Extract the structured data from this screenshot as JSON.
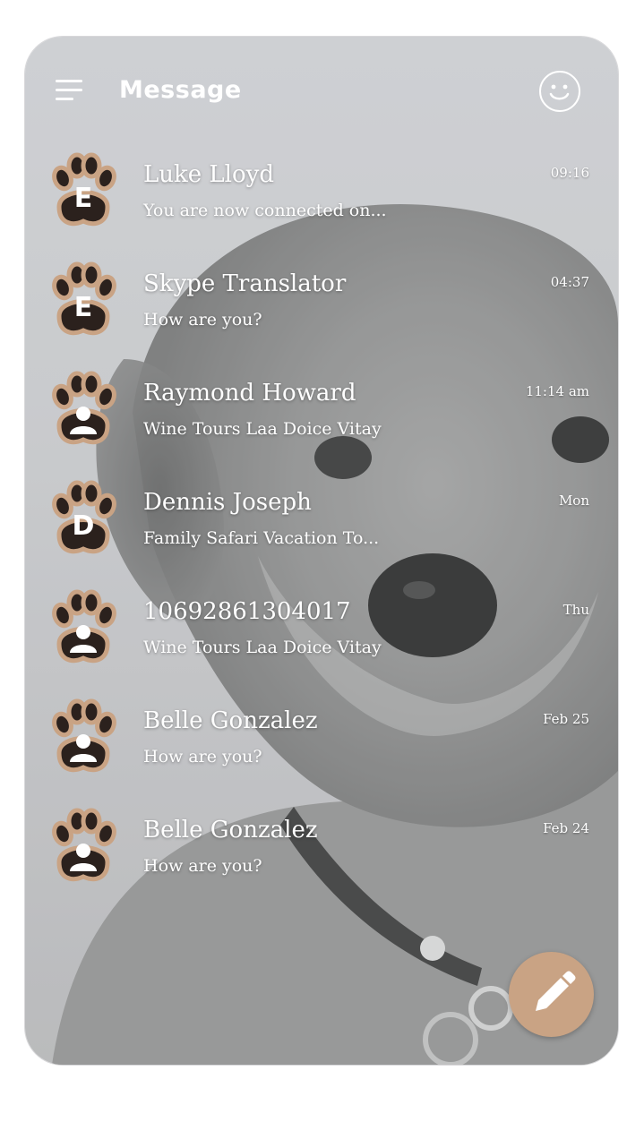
{
  "header": {
    "title": "Message",
    "menu_icon": "menu-icon",
    "emoji_icon": "smiley-icon"
  },
  "colors": {
    "accent": "#c9a384",
    "paw": "#2b211d",
    "paw_border": "#c9a384"
  },
  "conversations": [
    {
      "name": "Luke Lloyd",
      "preview": "You are now connected on...",
      "time": "09:16",
      "avatar_type": "letter",
      "avatar_letter": "E"
    },
    {
      "name": "Skype Translator",
      "preview": "How are you?",
      "time": "04:37",
      "avatar_type": "letter",
      "avatar_letter": "E"
    },
    {
      "name": "Raymond Howard",
      "preview": "Wine Tours Laa Doice Vitay",
      "time": "11:14 am",
      "avatar_type": "person",
      "avatar_letter": ""
    },
    {
      "name": "Dennis Joseph",
      "preview": "Family Safari Vacation To...",
      "time": "Mon",
      "avatar_type": "letter",
      "avatar_letter": "D"
    },
    {
      "name": "10692861304017",
      "preview": "Wine Tours Laa Doice Vitay",
      "time": "Thu",
      "avatar_type": "person",
      "avatar_letter": ""
    },
    {
      "name": "Belle Gonzalez",
      "preview": "How are you?",
      "time": "Feb 25",
      "avatar_type": "person",
      "avatar_letter": ""
    },
    {
      "name": "Belle Gonzalez",
      "preview": "How are you?",
      "time": "Feb 24",
      "avatar_type": "person",
      "avatar_letter": ""
    }
  ],
  "fab": {
    "icon": "pencil-icon"
  }
}
